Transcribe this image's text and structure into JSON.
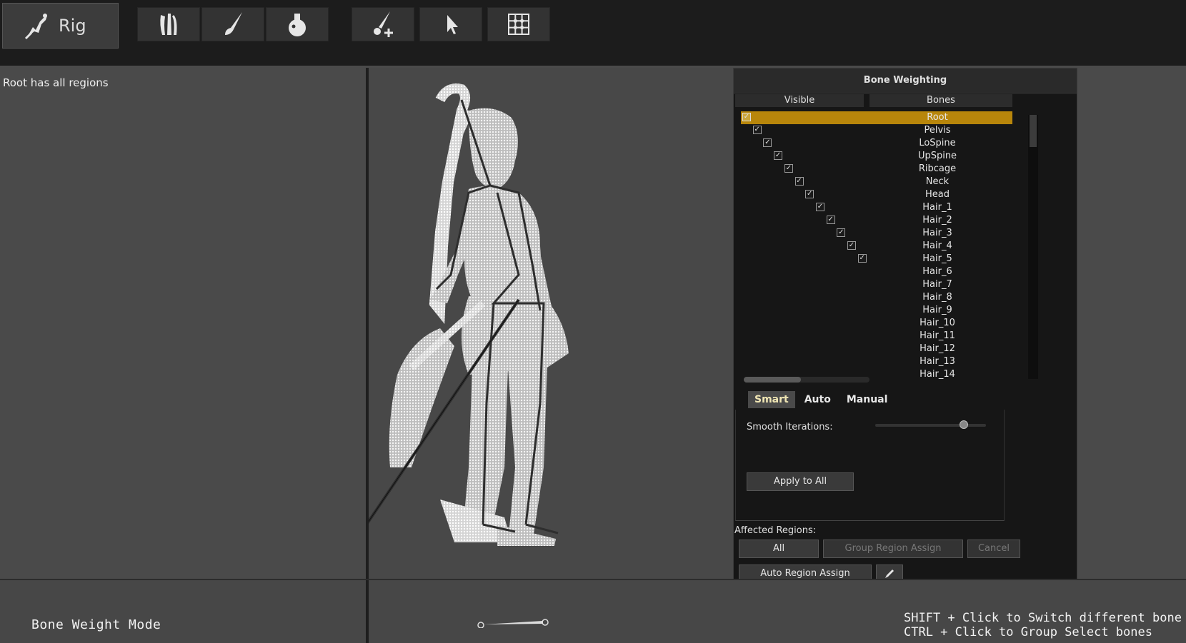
{
  "toolbar": {
    "rig_label": "Rig",
    "tools": [
      "bone-tool-icon",
      "brush-icon",
      "bucket-fill-icon",
      "add-bone-icon",
      "select-cursor-icon",
      "grid-icon"
    ]
  },
  "left_pane": {
    "message": "Root has all regions"
  },
  "panel": {
    "title": "Bone Weighting",
    "col_visible": "Visible",
    "col_bones": "Bones",
    "bones": [
      {
        "name": "Root",
        "checked": true,
        "selected": true
      },
      {
        "name": "Pelvis",
        "checked": true
      },
      {
        "name": "LoSpine",
        "checked": true
      },
      {
        "name": "UpSpine",
        "checked": true
      },
      {
        "name": "Ribcage",
        "checked": true
      },
      {
        "name": "Neck",
        "checked": true
      },
      {
        "name": "Head",
        "checked": true
      },
      {
        "name": "Hair_1",
        "checked": true
      },
      {
        "name": "Hair_2",
        "checked": true
      },
      {
        "name": "Hair_3",
        "checked": true
      },
      {
        "name": "Hair_4",
        "checked": true
      },
      {
        "name": "Hair_5",
        "checked": true
      },
      {
        "name": "Hair_6",
        "checked": false
      },
      {
        "name": "Hair_7",
        "checked": false
      },
      {
        "name": "Hair_8",
        "checked": false
      },
      {
        "name": "Hair_9",
        "checked": false
      },
      {
        "name": "Hair_10",
        "checked": false
      },
      {
        "name": "Hair_11",
        "checked": false
      },
      {
        "name": "Hair_12",
        "checked": false
      },
      {
        "name": "Hair_13",
        "checked": false
      },
      {
        "name": "Hair_14",
        "checked": false
      }
    ],
    "tabs": [
      "Smart",
      "Auto",
      "Manual"
    ],
    "active_tab": "Smart",
    "smooth_label": "Smooth Iterations:",
    "smooth_value_fraction": 0.8,
    "apply_all": "Apply to All",
    "affected_label": "Affected Regions:",
    "btn_all": "All",
    "btn_group": "Group Region Assign",
    "btn_cancel": "Cancel",
    "btn_auto": "Auto Region Assign"
  },
  "bottom": {
    "mode": "Bone Weight Mode",
    "hint1": "SHIFT + Click to Switch different bone",
    "hint2": "CTRL + Click to Group Select bones"
  },
  "colors": {
    "selected_row": "#b8860b",
    "panel_bg": "#161616",
    "toolbar_bg": "#1c1c1c"
  }
}
